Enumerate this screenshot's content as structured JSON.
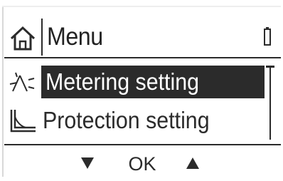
{
  "header": {
    "home_icon": "home-icon",
    "title": "Menu",
    "battery_icon": "battery-icon"
  },
  "menu": {
    "items": [
      {
        "label": "Metering setting",
        "icon": "metering-icon",
        "selected": true
      },
      {
        "label": "Protection setting",
        "icon": "protection-icon",
        "selected": false
      }
    ]
  },
  "softkeys": {
    "down_icon": "triangle-down-icon",
    "ok_label": "OK",
    "up_icon": "triangle-up-icon"
  },
  "colors": {
    "foreground": "#2b2b2b",
    "background": "#ffffff",
    "highlight_text": "#ffffff"
  }
}
